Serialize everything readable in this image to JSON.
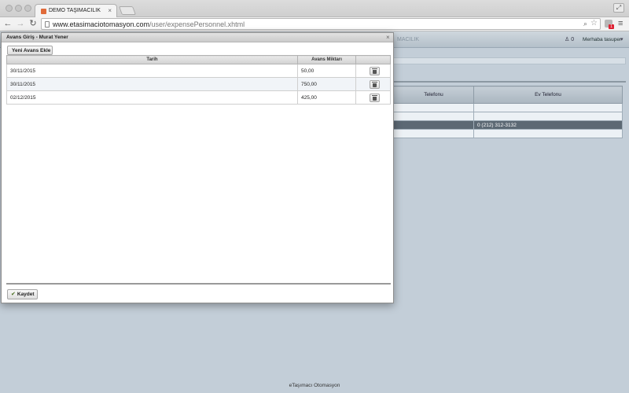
{
  "browser": {
    "tab_title": "DEMO TAŞIMACILIK",
    "tab_close": "×",
    "url_host": "www.etasimaciotomasyon.com",
    "url_path": "/user/expensePersonnel.xhtml",
    "ext_badge": "1"
  },
  "app": {
    "logo_fragment": "MACILIK",
    "notification_count": "0",
    "greeting": "Merhaba tasuper",
    "table": {
      "headers": [
        "Telefonu",
        "Ev Telefonu"
      ],
      "rows": [
        [
          "",
          ""
        ],
        [
          "",
          ""
        ],
        [
          "",
          "0 (212) 312-3132"
        ],
        [
          "",
          ""
        ]
      ]
    },
    "footer": "eTaşımacı Otomasyon"
  },
  "dialog": {
    "title": "Avans Giriş - Murat Yener",
    "close": "×",
    "add_button": "Yeni Avans Ekle",
    "save_button": "Kaydet",
    "columns": [
      "Tarih",
      "Avans Miktarı",
      ""
    ],
    "rows": [
      {
        "date": "30/11/2015",
        "amount": "50,00"
      },
      {
        "date": "30/11/2015",
        "amount": "750,00"
      },
      {
        "date": "02/12/2015",
        "amount": "425,00"
      }
    ]
  }
}
